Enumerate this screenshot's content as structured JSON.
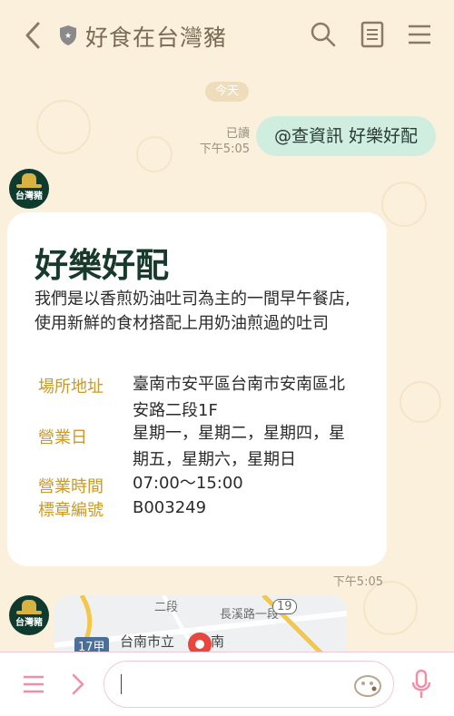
{
  "header": {
    "title": "好食在台灣豬"
  },
  "chat": {
    "date_divider": "今天",
    "outgoing": {
      "read_label": "已讀",
      "time": "下午5:05",
      "text": "@查資訊 好樂好配"
    },
    "bot_avatar_label": "台灣豬",
    "card": {
      "title": "好樂好配",
      "description": "我們是以香煎奶油吐司為主的一間早午餐店,使用新鮮的食材搭配上用奶油煎過的吐司",
      "rows": [
        {
          "label": "場所地址",
          "value": "臺南市安平區台南市安南區北安路二段1F"
        },
        {
          "label": "營業日",
          "value": "星期一，星期二，星期四，星期五，星期六，星期日"
        },
        {
          "label": "營業時間",
          "value": "07:00～15:00"
        },
        {
          "label": "標章編號",
          "value": "B003249"
        }
      ],
      "time": "下午5:05"
    },
    "map": {
      "road_1": "二段",
      "road_2": "長溪路一段",
      "road_3": "長溪路一段",
      "route_a": "19",
      "route_b": "17甲",
      "place": "台南市立",
      "place_2": "南"
    }
  },
  "colors": {
    "background": "#fbf0dc",
    "accent_pink": "#ef8fa8",
    "bubble_green": "#cfeee0",
    "label_gold": "#c99a2a"
  }
}
